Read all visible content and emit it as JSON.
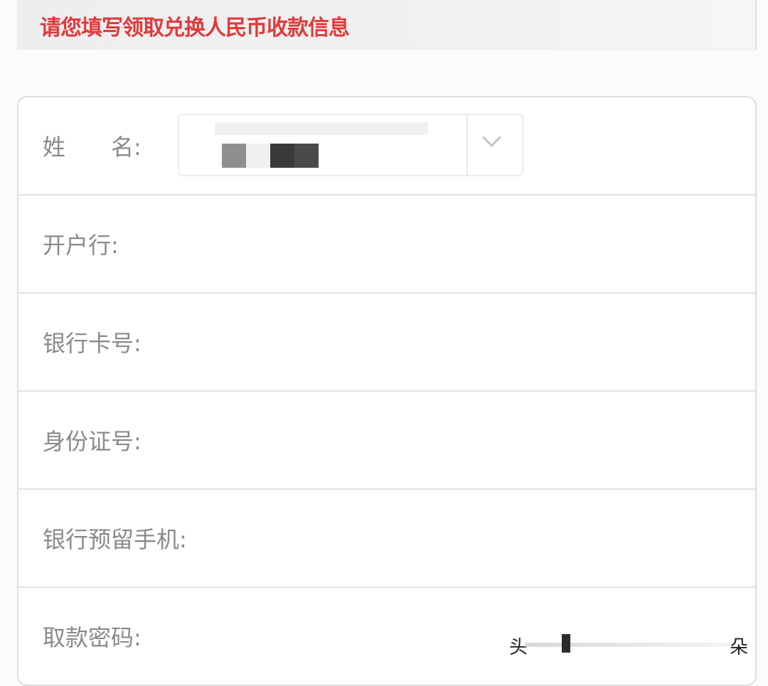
{
  "header": {
    "title": "请您填写领取兑换人民币收款信息",
    "title_color": "#e23a3a"
  },
  "form": {
    "fields": [
      {
        "label": "姓　　名:"
      },
      {
        "label": "开户行:"
      },
      {
        "label": "银行卡号:"
      },
      {
        "label": "身份证号:"
      },
      {
        "label": "银行预留手机:"
      },
      {
        "label": "取款密码:"
      }
    ],
    "bank_select": {
      "selected_value_icon": "pixelated-redacted-value",
      "arrow_icon": "chevron-down-icon"
    }
  },
  "watermark": {
    "left": "头",
    "right": "朵"
  }
}
